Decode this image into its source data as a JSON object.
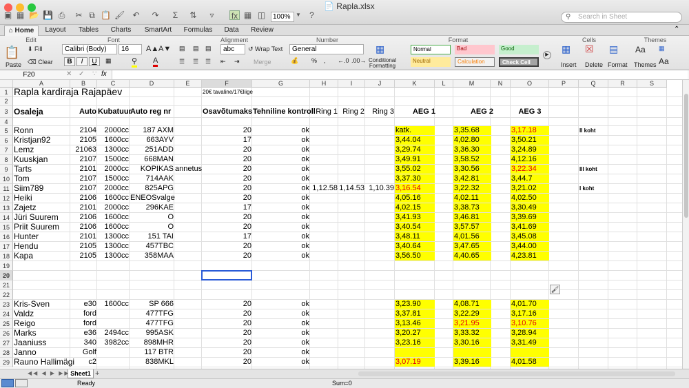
{
  "window": {
    "title": "Rapla.xlsx"
  },
  "toolbar": {
    "zoom": "100%",
    "search_placeholder": "Search in Sheet"
  },
  "tabs": [
    "Home",
    "Layout",
    "Tables",
    "Charts",
    "SmartArt",
    "Formulas",
    "Data",
    "Review"
  ],
  "ribbon": {
    "groups": [
      "Edit",
      "Font",
      "Alignment",
      "Number",
      "Format",
      "Cells",
      "Themes"
    ],
    "paste": "Paste",
    "fill": "Fill",
    "clear": "Clear",
    "font_name": "Calibri (Body)",
    "font_size": "16",
    "wrap_text": "Wrap Text",
    "merge": "Merge",
    "number_format": "General",
    "conditional_formatting": "Conditional Formatting",
    "styles": {
      "normal": "Normal",
      "bad": "Bad",
      "good": "Good",
      "neutral": "Neutral",
      "calculation": "Calculation",
      "check_cell": "Check Cell"
    },
    "insert": "Insert",
    "delete": "Delete",
    "format": "Format",
    "themes": "Themes",
    "bold": "B",
    "italic": "I",
    "underline": "U",
    "abc": "abc",
    "percent": "%",
    "comma": ","
  },
  "formula_bar": {
    "cell_ref": "F20",
    "fx": "fx",
    "value": ""
  },
  "columns": [
    "A",
    "B",
    "C",
    "D",
    "E",
    "F",
    "G",
    "H",
    "I",
    "J",
    "K",
    "L",
    "M",
    "N",
    "O",
    "P",
    "Q",
    "R",
    "S"
  ],
  "rows_visible": [
    "1",
    "2",
    "3",
    "4",
    "5",
    "6",
    "7",
    "8",
    "9",
    "10",
    "11",
    "12",
    "13",
    "14",
    "15",
    "16",
    "17",
    "18",
    "19",
    "20",
    "21",
    "22",
    "23",
    "24",
    "25",
    "26",
    "27",
    "28",
    "29"
  ],
  "sheet": {
    "title": "Rapla kardiraja Rajapäev",
    "note": "20€ tavaline/17€liige",
    "headers": {
      "a": "Osaleja",
      "b": "Auto",
      "c": "Kubatuur",
      "d": "Auto reg nr",
      "f": "Osavõtumaks",
      "g": "Tehniline kontroll",
      "h": "Ring 1",
      "i": "Ring 2",
      "j": "Ring 3",
      "k": "AEG 1",
      "m": "AEG 2",
      "o": "AEG 3"
    },
    "group1": [
      {
        "row": 5,
        "a": "Ronn",
        "b": "2104",
        "c": "2000cc",
        "d": "187 AXM",
        "e": "",
        "f": "20",
        "g": "ok",
        "h": "",
        "i": "",
        "j": "",
        "k": "katk.",
        "kr": false,
        "m": "3,35.68",
        "mr": false,
        "o": "3,17.18",
        "or": true,
        "q": "II koht"
      },
      {
        "row": 6,
        "a": "Kristjan92",
        "b": "2105",
        "c": "1600cc",
        "d": "663AYV",
        "e": "",
        "f": "17",
        "g": "ok",
        "h": "",
        "i": "",
        "j": "",
        "k": "3,44.04",
        "kr": false,
        "m": "4,02.80",
        "mr": false,
        "o": "3,50.21",
        "or": false,
        "q": ""
      },
      {
        "row": 7,
        "a": "Lemz",
        "b": "21063",
        "c": "1300cc",
        "d": "251ADD",
        "e": "",
        "f": "20",
        "g": "ok",
        "h": "",
        "i": "",
        "j": "",
        "k": "3,29.74",
        "kr": false,
        "m": "3,36.30",
        "mr": false,
        "o": "3,24.89",
        "or": false,
        "q": ""
      },
      {
        "row": 8,
        "a": "Kuuskjan",
        "b": "2107",
        "c": "1500cc",
        "d": "668MAN",
        "e": "",
        "f": "20",
        "g": "ok",
        "h": "",
        "i": "",
        "j": "",
        "k": "3,49.91",
        "kr": false,
        "m": "3,58.52",
        "mr": false,
        "o": "4,12.16",
        "or": false,
        "q": ""
      },
      {
        "row": 9,
        "a": "Tarts",
        "b": "2101",
        "c": "2000cc",
        "d": "KOPIKAS",
        "e": "annetus",
        "f": "20",
        "g": "ok",
        "h": "",
        "i": "",
        "j": "",
        "k": "3,55.02",
        "kr": false,
        "m": "3,30.56",
        "mr": false,
        "o": "3,22.34",
        "or": true,
        "q": "III koht"
      },
      {
        "row": 10,
        "a": "Tom",
        "b": "2107",
        "c": "1500cc",
        "d": "714AAK",
        "e": "",
        "f": "20",
        "g": "ok",
        "h": "",
        "i": "",
        "j": "",
        "k": "3,37.30",
        "kr": false,
        "m": "3,42.81",
        "mr": false,
        "o": "3,44.7",
        "or": false,
        "q": ""
      },
      {
        "row": 11,
        "a": "Siim789",
        "b": "2107",
        "c": "2000cc",
        "d": "825APG",
        "e": "",
        "f": "20",
        "g": "ok",
        "h": "1,12.58",
        "i": "1,14.53",
        "j": "1,10.39",
        "k": "3,16.54",
        "kr": true,
        "m": "3,22.32",
        "mr": false,
        "o": "3,21.02",
        "or": false,
        "q": "I koht"
      },
      {
        "row": 12,
        "a": "Heiki",
        "b": "2106",
        "c": "1600cc",
        "d": "ENEOSvalge",
        "e": "",
        "f": "20",
        "g": "ok",
        "h": "",
        "i": "",
        "j": "",
        "k": "4,05.16",
        "kr": false,
        "m": "4,02.11",
        "mr": false,
        "o": "4,02.50",
        "or": false,
        "q": ""
      },
      {
        "row": 13,
        "a": "Zajetz",
        "b": "2101",
        "c": "2000cc",
        "d": "296KAE",
        "e": "",
        "f": "17",
        "g": "ok",
        "h": "",
        "i": "",
        "j": "",
        "k": "4,02.15",
        "kr": false,
        "m": "3,38.73",
        "mr": false,
        "o": "3,30.49",
        "or": false,
        "q": ""
      },
      {
        "row": 14,
        "a": "Jüri Suurem",
        "b": "2106",
        "c": "1600cc",
        "d": "O",
        "e": "",
        "f": "20",
        "g": "ok",
        "h": "",
        "i": "",
        "j": "",
        "k": "3,41.93",
        "kr": false,
        "m": "3,46.81",
        "mr": false,
        "o": "3,39.69",
        "or": false,
        "q": ""
      },
      {
        "row": 15,
        "a": "Priit Suurem",
        "b": "2106",
        "c": "1600cc",
        "d": "O",
        "e": "",
        "f": "20",
        "g": "ok",
        "h": "",
        "i": "",
        "j": "",
        "k": "3,40.54",
        "kr": false,
        "m": "3,57.57",
        "mr": false,
        "o": "3,41.69",
        "or": false,
        "q": ""
      },
      {
        "row": 16,
        "a": "Hunter",
        "b": "2101",
        "c": "1300cc",
        "d": "151 TAI",
        "e": "",
        "f": "17",
        "g": "ok",
        "h": "",
        "i": "",
        "j": "",
        "k": "3,48.11",
        "kr": false,
        "m": "4,01.56",
        "mr": false,
        "o": "3,45.08",
        "or": false,
        "q": ""
      },
      {
        "row": 17,
        "a": "Hendu",
        "b": "2105",
        "c": "1300cc",
        "d": "457TBC",
        "e": "",
        "f": "20",
        "g": "ok",
        "h": "",
        "i": "",
        "j": "",
        "k": "3,40.64",
        "kr": false,
        "m": "3,47.65",
        "mr": false,
        "o": "3,44.00",
        "or": false,
        "q": ""
      },
      {
        "row": 18,
        "a": "Kapa",
        "b": "2105",
        "c": "1300cc",
        "d": "358MAA",
        "e": "",
        "f": "20",
        "g": "ok",
        "h": "",
        "i": "",
        "j": "",
        "k": "3,56.50",
        "kr": false,
        "m": "4,40.65",
        "mr": false,
        "o": "4,23.81",
        "or": false,
        "q": ""
      }
    ],
    "group2": [
      {
        "row": 23,
        "a": "Kris-Sven",
        "b": "e30",
        "c": "1600cc",
        "d": "SP 666",
        "e": "",
        "f": "20",
        "g": "ok",
        "h": "",
        "i": "",
        "j": "",
        "k": "3,23.90",
        "kr": false,
        "m": "4,08.71",
        "mr": false,
        "o": "4,01.70",
        "or": false,
        "q": ""
      },
      {
        "row": 24,
        "a": "Valdz",
        "b": "ford",
        "c": "",
        "d": "477TFG",
        "e": "",
        "f": "20",
        "g": "ok",
        "h": "",
        "i": "",
        "j": "",
        "k": "3,37.81",
        "kr": false,
        "m": "3,22.29",
        "mr": false,
        "o": "3,17.16",
        "or": false,
        "q": ""
      },
      {
        "row": 25,
        "a": "Reigo",
        "b": "ford",
        "c": "",
        "d": "477TFG",
        "e": "",
        "f": "20",
        "g": "ok",
        "h": "",
        "i": "",
        "j": "",
        "k": "3,13.46",
        "kr": false,
        "m": "3,21.95",
        "mr": true,
        "o": "3,10.76",
        "or": true,
        "q": ""
      },
      {
        "row": 26,
        "a": "Marks",
        "b": "e36",
        "c": "2494cc",
        "d": "995ASK",
        "e": "",
        "f": "20",
        "g": "ok",
        "h": "",
        "i": "",
        "j": "",
        "k": "3,20.27",
        "kr": false,
        "m": "3,33.32",
        "mr": false,
        "o": "3,28.94",
        "or": false,
        "q": ""
      },
      {
        "row": 27,
        "a": "Jaaniuss",
        "b": "340",
        "c": "3982cc",
        "d": "898MHR",
        "e": "",
        "f": "20",
        "g": "ok",
        "h": "",
        "i": "",
        "j": "",
        "k": "3,23.16",
        "kr": false,
        "m": "3,30.16",
        "mr": false,
        "o": "3,31.49",
        "or": false,
        "q": ""
      },
      {
        "row": 28,
        "a": "Janno",
        "b": "Golf",
        "c": "",
        "d": "117 BTR",
        "e": "",
        "f": "20",
        "g": "ok",
        "h": "",
        "i": "",
        "j": "",
        "k": "",
        "kr": false,
        "m": "",
        "mr": false,
        "o": "",
        "or": false,
        "q": ""
      },
      {
        "row": 29,
        "a": "Rauno Hallimägi",
        "b": "c2",
        "c": "",
        "d": "838MKL",
        "e": "",
        "f": "20",
        "g": "ok",
        "h": "",
        "i": "",
        "j": "",
        "k": "3,07.19",
        "kr": true,
        "m": "3,39.16",
        "mr": false,
        "o": "4,01.58",
        "or": false,
        "q": ""
      }
    ]
  },
  "sheet_tabs": [
    "Sheet1"
  ],
  "status": {
    "ready": "Ready",
    "sum": "Sum=0"
  }
}
